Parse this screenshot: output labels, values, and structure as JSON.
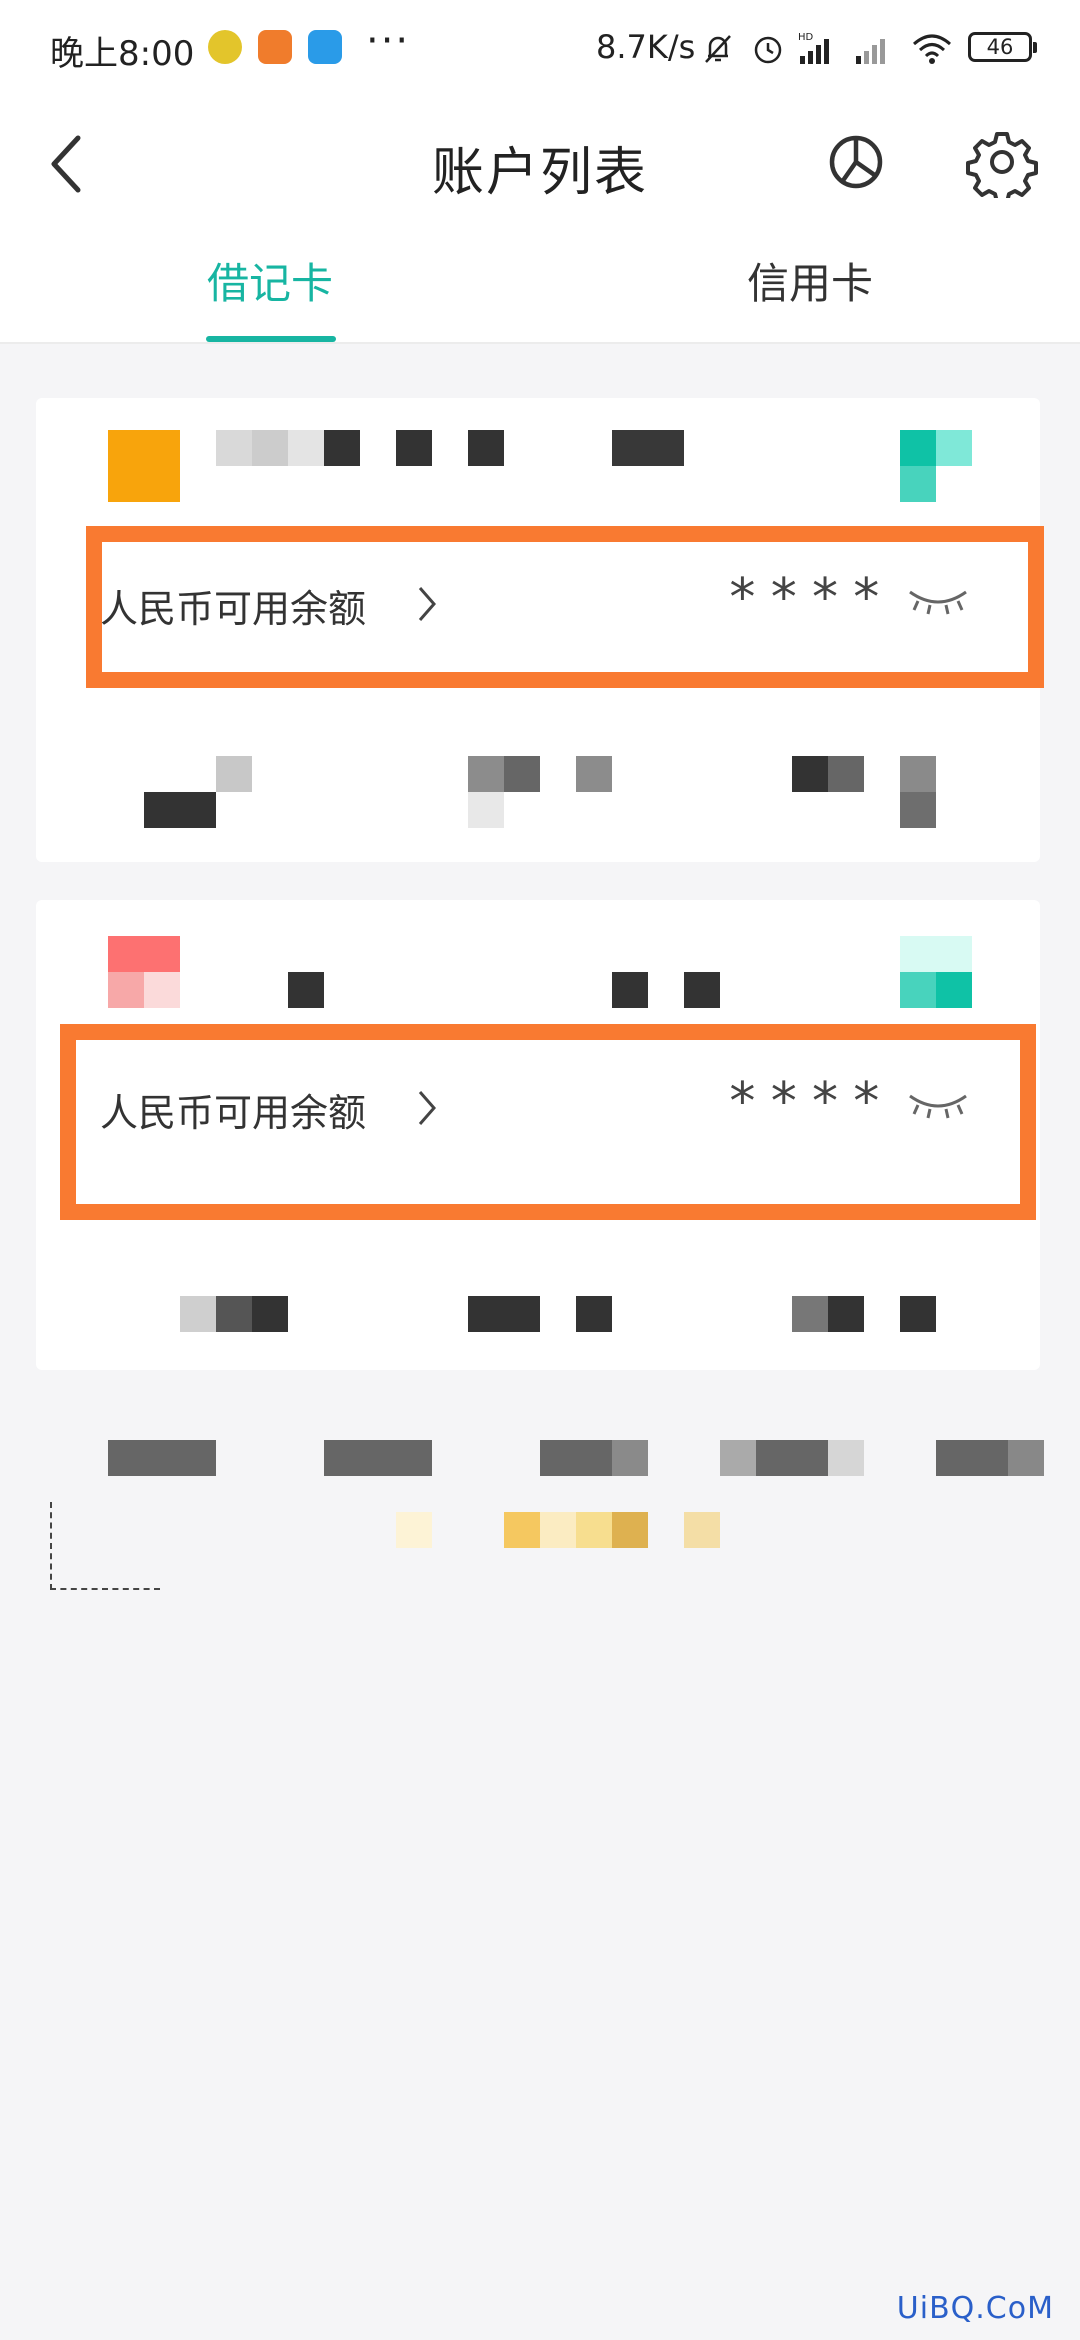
{
  "status_bar": {
    "time": "晚上8:00",
    "more": "···",
    "net_speed": "8.7K/s",
    "battery": "46"
  },
  "header": {
    "title": "账户列表",
    "back_icon": "chevron-left-icon",
    "chart_icon": "pie-chart-icon",
    "settings_icon": "gear-icon"
  },
  "tabs": [
    {
      "label": "借记卡",
      "active": true
    },
    {
      "label": "信用卡",
      "active": false
    }
  ],
  "accounts": [
    {
      "balance_label": "人民币可用余额",
      "balance_value": "****"
    },
    {
      "balance_label": "人民币可用余额",
      "balance_value": "****"
    }
  ],
  "colors": {
    "accent": "#17b5a2",
    "highlight": "#f97a31",
    "background": "#f5f5f7"
  },
  "watermark": "UiBQ.CoM"
}
